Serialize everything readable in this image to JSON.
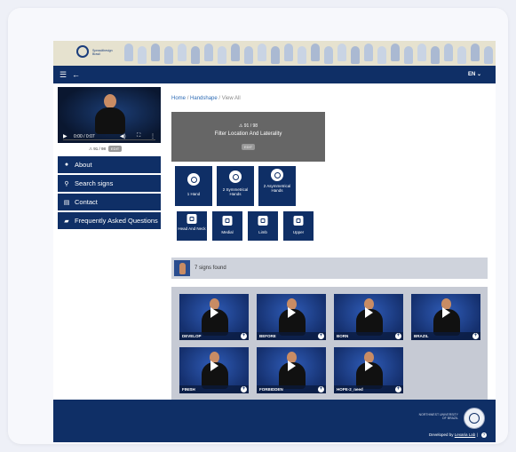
{
  "app": {
    "banner_logo_text": "Spreadthesign Brasil"
  },
  "navbar": {
    "menu_icon": "hamburger-icon",
    "back_icon": "arrow-left-icon",
    "language": "EN ⌄"
  },
  "sidebar": {
    "video": {
      "time": "0:00 / 0:07"
    },
    "warning": {
      "label": "⚠ 91 / 98",
      "pill": "EDIT"
    },
    "items": [
      {
        "label": "About",
        "icon": "info-icon"
      },
      {
        "label": "Search signs",
        "icon": "search-icon"
      },
      {
        "label": "Contact",
        "icon": "contact-card-icon"
      },
      {
        "label": "Frequently Asked Questions",
        "icon": "chat-icon"
      }
    ]
  },
  "breadcrumb": {
    "home": "Home",
    "sep1": "/",
    "handshape": "Handshape",
    "sep2": "/",
    "current": "View All"
  },
  "filter": {
    "warning": "⚠ 91 / 98",
    "title": "Filter Location And Laterality",
    "pill": "EDIT",
    "hands": [
      {
        "label": "1 Hand"
      },
      {
        "label": "2 Symmetrical Hands"
      },
      {
        "label": "2 Asymmetrical Hands"
      }
    ],
    "locations": [
      {
        "label": "Head And Neck"
      },
      {
        "label": "Medial"
      },
      {
        "label": "Limb"
      },
      {
        "label": "Upper"
      }
    ]
  },
  "results": {
    "count_text": "7 signs found",
    "signs": [
      {
        "label": "DEVELOP"
      },
      {
        "label": "BEFORE"
      },
      {
        "label": "BORN"
      },
      {
        "label": "BRAZIL"
      },
      {
        "label": "FINISH"
      },
      {
        "label": "FORBIDDEN"
      },
      {
        "label": "HOPE-2_need"
      }
    ],
    "plus_symbol": "+"
  },
  "footer": {
    "university": "NORTHWEST UNIVERSITY OF BRAZIL",
    "developed_by": "Developed by",
    "developer": "Lexaria Lab",
    "separator": "|",
    "help": "?"
  },
  "colors": {
    "navy": "#0f2f66",
    "banner": "#e6e2cf",
    "results_bg": "#c6cad4"
  }
}
